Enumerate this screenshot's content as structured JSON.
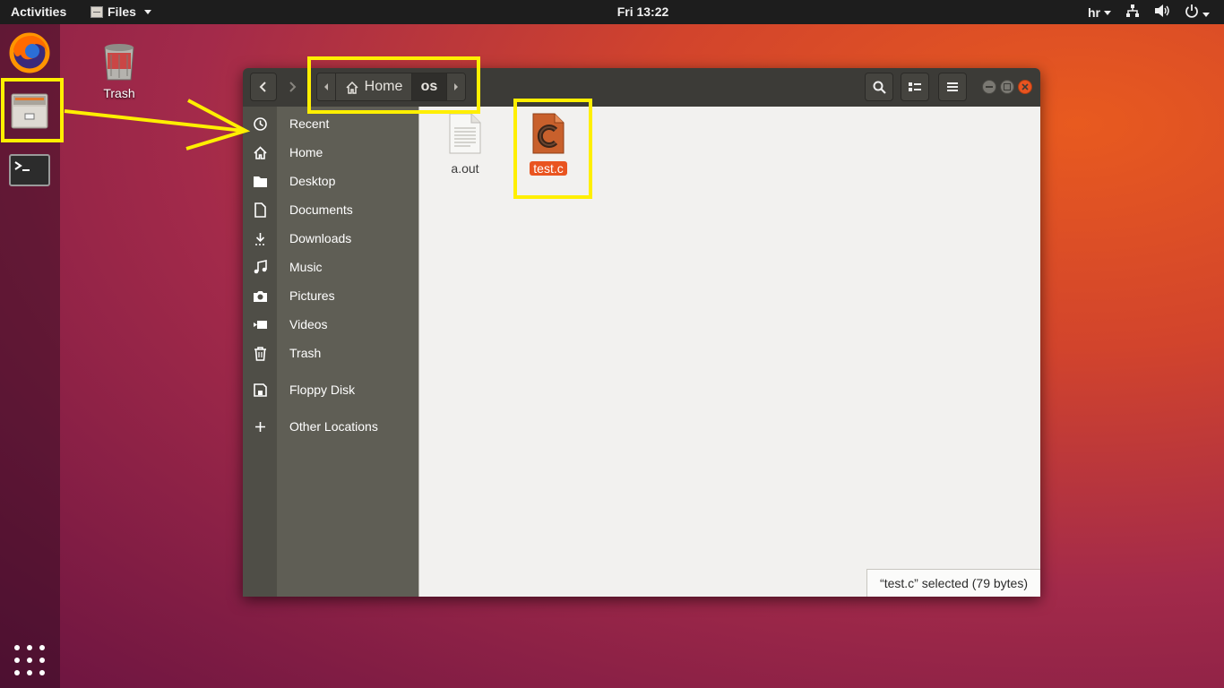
{
  "topbar": {
    "activities": "Activities",
    "app_menu": "Files",
    "clock": "Fri 13:22",
    "user": "hr"
  },
  "dock": {
    "items": [
      "firefox-icon",
      "files-icon",
      "terminal-icon"
    ],
    "show_apps": "apps-grid-icon"
  },
  "desktop": {
    "trash_label": "Trash"
  },
  "window": {
    "pathbar": {
      "home": "Home",
      "current": "os"
    },
    "sidebar": {
      "items": [
        {
          "label": "Recent",
          "icon": "clock-icon"
        },
        {
          "label": "Home",
          "icon": "home-icon"
        },
        {
          "label": "Desktop",
          "icon": "folder-icon"
        },
        {
          "label": "Documents",
          "icon": "document-icon"
        },
        {
          "label": "Downloads",
          "icon": "download-icon"
        },
        {
          "label": "Music",
          "icon": "music-icon"
        },
        {
          "label": "Pictures",
          "icon": "camera-icon"
        },
        {
          "label": "Videos",
          "icon": "video-icon"
        },
        {
          "label": "Trash",
          "icon": "trash-icon"
        },
        {
          "label": "Floppy Disk",
          "icon": "floppy-icon"
        },
        {
          "label": "Other Locations",
          "icon": "plus-icon"
        }
      ]
    },
    "files": [
      {
        "name": "a.out",
        "icon": "generic-file-icon",
        "selected": false
      },
      {
        "name": "test.c",
        "icon": "c-source-icon",
        "selected": true
      }
    ],
    "status": "“test.c” selected  (79 bytes)"
  },
  "colors": {
    "accent": "#e95420",
    "annotation": "#ffef00",
    "headerbar": "#3c3b37",
    "sidebar": "#5f5e55"
  }
}
